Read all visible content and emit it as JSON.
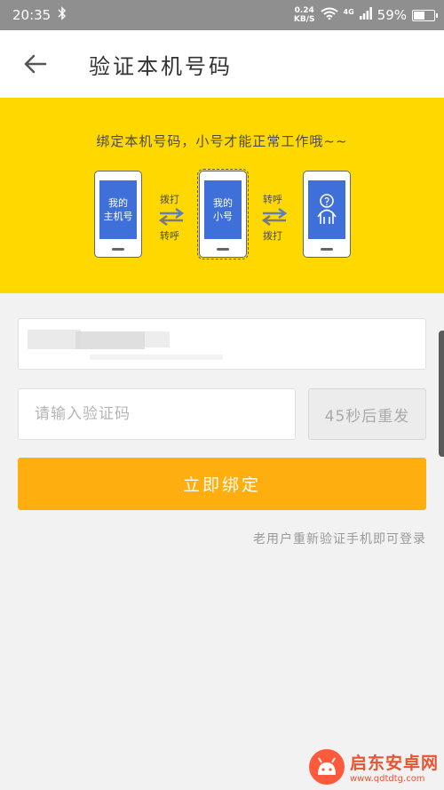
{
  "status_bar": {
    "time": "20:35",
    "net_speed_value": "0.24",
    "net_speed_unit": "KB/S",
    "network_type": "4G",
    "battery_percent": "59%",
    "battery_level": 0.59
  },
  "header": {
    "title": "验证本机号码"
  },
  "banner": {
    "text": "绑定本机号码，小号才能正常工作哦~~",
    "phones": {
      "main": "我的\n主机号",
      "small": "我的\n小号"
    },
    "flow_left": {
      "top": "拨打",
      "bottom": "转呼"
    },
    "flow_right": {
      "top": "转呼",
      "bottom": "拨打"
    },
    "phone_main_label": "我的主机号",
    "phone_small_label": "我的小号"
  },
  "form": {
    "code_placeholder": "请输入验证码",
    "resend_label": "45秒后重发",
    "bind_label": "立即绑定",
    "hint": "老用户重新验证手机即可登录"
  },
  "watermark": {
    "name": "启东安卓网",
    "url": "www.qdtdtg.com"
  },
  "colors": {
    "banner": "#ffd800",
    "primary_button": "#ffae0f",
    "phone_screen": "#3f6fd8",
    "status_bar": "#8f8f8f"
  }
}
